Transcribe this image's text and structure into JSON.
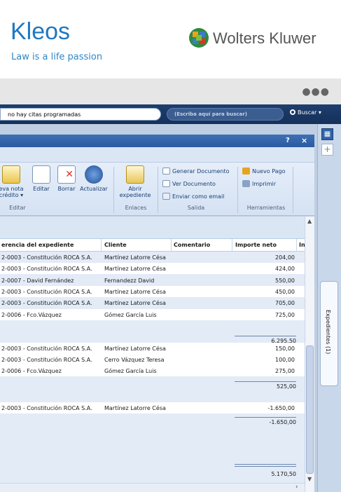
{
  "brand": {
    "name": "Kleos",
    "tagline": "Law is a life passion",
    "company": "Wolters Kluwer"
  },
  "browser_dots": "●●●",
  "topbar": {
    "notification": "no hay citas programadas",
    "search_placeholder": "(Escriba aquí para buscar)",
    "search_button": "Buscar"
  },
  "window": {
    "help": "?",
    "close": "×"
  },
  "ribbon": {
    "new_note": "eva nota\ncrédito ▾",
    "edit": "Editar",
    "delete": "Borrar",
    "refresh": "Actualizar",
    "open_file": "Abrir\nexpediente",
    "generate_doc": "Generar Documento",
    "view_doc": "Ver Documento",
    "send_email": "Enviar como email",
    "new_payment": "Nuevo Pago",
    "print": "Imprimir",
    "groups": {
      "editar": "Editar",
      "enlaces": "Enlaces",
      "salida": "Salida",
      "herramientas": "Herramientas"
    }
  },
  "side_panel": {
    "tab_label": "Expedientes (1)",
    "grid_icon": "grid-icon",
    "add_icon": "plus-icon"
  },
  "columns": [
    "erencia del expediente",
    "Cliente",
    "Comentario",
    "Importe neto",
    "In"
  ],
  "rows": [
    {
      "ref": "2-0003 - Constitución ROCA S.A.",
      "client": "Martínez Latorre Césa",
      "amount": "204,00",
      "shade": "blue"
    },
    {
      "ref": "2-0003 - Constitución ROCA S.A.",
      "client": "Martínez Latorre Césa",
      "amount": "424,00",
      "shade": "white"
    },
    {
      "ref": "2-0007 - David Fernández",
      "client": "Fernandezz David",
      "amount": "550,00",
      "shade": "blue"
    },
    {
      "ref": "2-0003 - Constitución ROCA S.A.",
      "client": "Martínez Latorre Césa",
      "amount": "450,00",
      "shade": "white"
    },
    {
      "ref": "2-0003 - Constitución ROCA S.A.",
      "client": "Martínez Latorre Césa",
      "amount": "705,00",
      "shade": "blue"
    },
    {
      "ref": "2-0006 - Fco.Vázquez",
      "client": "Gómez García Luis",
      "amount": "725,00",
      "shade": "white"
    },
    {
      "ref": "2-0003 - Constitución ROCA S.A.",
      "client": "Martínez Latorre Césa",
      "amount": "150,00",
      "shade": "white"
    },
    {
      "ref": "2-0003 - Constitución ROCA S.A.",
      "client": "Cerro Vázquez Teresa",
      "amount": "100,00",
      "shade": "white"
    },
    {
      "ref": "2-0006 - Fco.Vázquez",
      "client": "Gómez García Luis",
      "amount": "275,00",
      "shade": "white"
    },
    {
      "ref": "2-0003 - Constitución ROCA S.A.",
      "client": "Martínez Latorre Césa",
      "amount": "-1.650,00",
      "shade": "white"
    }
  ],
  "totals": [
    "6.295,50",
    "525,00",
    "-1.650,00",
    "5.170,50"
  ],
  "colors": {
    "accent": "#1f78c1",
    "topbar": "#1e3e6e",
    "titlebar": "#2a5aa0"
  }
}
